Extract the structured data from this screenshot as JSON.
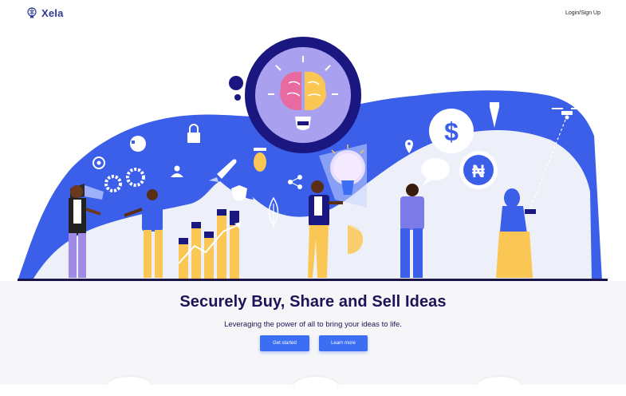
{
  "brand": {
    "name": "Xela"
  },
  "nav": {
    "login_label": "Login/Sign Up"
  },
  "hero": {
    "headline": "Securely Buy, Share and Sell Ideas",
    "subline": "Leveraging the power of all to bring your ideas to life."
  },
  "buttons": {
    "primary": "Get started",
    "secondary": "Learn more"
  },
  "colors": {
    "brand_blue": "#3b6ef2",
    "navy": "#1c1457",
    "background": "#f6f6f8",
    "accent_yellow": "#fbc754"
  },
  "icons": [
    "brain-lightbulb-icon",
    "lock-icon",
    "dollar-icon",
    "naira-icon",
    "drone-icon",
    "rocket-icon",
    "shield-icon",
    "leaf-icon",
    "pin-icon",
    "share-icon",
    "gear-icon",
    "chat-bubble-icon"
  ]
}
